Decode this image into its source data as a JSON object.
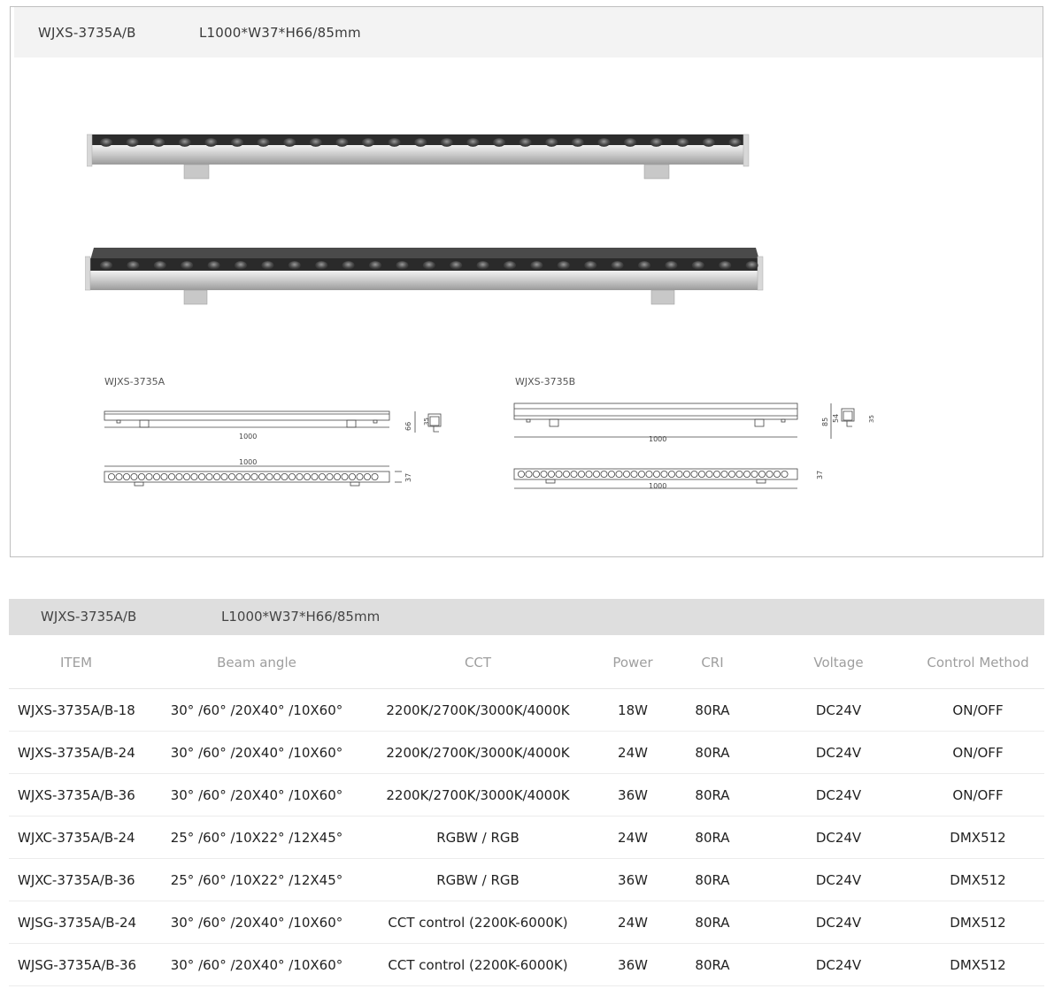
{
  "product": {
    "model": "WJXS-3735A/B",
    "size": "L1000*W37*H66/85mm"
  },
  "drawings": {
    "a": {
      "label": "WJXS-3735A",
      "length": "1000",
      "height": "66",
      "inner": "35",
      "width": "37"
    },
    "b": {
      "label": "WJXS-3735B",
      "length": "1000",
      "height": "85",
      "mid": "54",
      "inner": "35",
      "width": "37"
    }
  },
  "spec_header": {
    "model": "WJXS-3735A/B",
    "size": "L1000*W37*H66/85mm"
  },
  "table": {
    "columns": [
      "ITEM",
      "Beam angle",
      "CCT",
      "Power",
      "CRI",
      "Voltage",
      "Control Method"
    ],
    "rows": [
      [
        "WJXS-3735A/B-18",
        "30° /60° /20X40° /10X60°",
        "2200K/2700K/3000K/4000K",
        "18W",
        "80RA",
        "DC24V",
        "ON/OFF"
      ],
      [
        "WJXS-3735A/B-24",
        "30° /60° /20X40° /10X60°",
        "2200K/2700K/3000K/4000K",
        "24W",
        "80RA",
        "DC24V",
        "ON/OFF"
      ],
      [
        "WJXS-3735A/B-36",
        "30° /60° /20X40° /10X60°",
        "2200K/2700K/3000K/4000K",
        "36W",
        "80RA",
        "DC24V",
        "ON/OFF"
      ],
      [
        "WJXC-3735A/B-24",
        "25° /60° /10X22° /12X45°",
        "RGBW / RGB",
        "24W",
        "80RA",
        "DC24V",
        "DMX512"
      ],
      [
        "WJXC-3735A/B-36",
        "25° /60° /10X22° /12X45°",
        "RGBW / RGB",
        "36W",
        "80RA",
        "DC24V",
        "DMX512"
      ],
      [
        "WJSG-3735A/B-24",
        "30° /60° /20X40° /10X60°",
        "CCT control (2200K-6000K)",
        "24W",
        "80RA",
        "DC24V",
        "DMX512"
      ],
      [
        "WJSG-3735A/B-36",
        "30° /60° /20X40° /10X60°",
        "CCT control (2200K-6000K)",
        "36W",
        "80RA",
        "DC24V",
        "DMX512"
      ]
    ]
  }
}
